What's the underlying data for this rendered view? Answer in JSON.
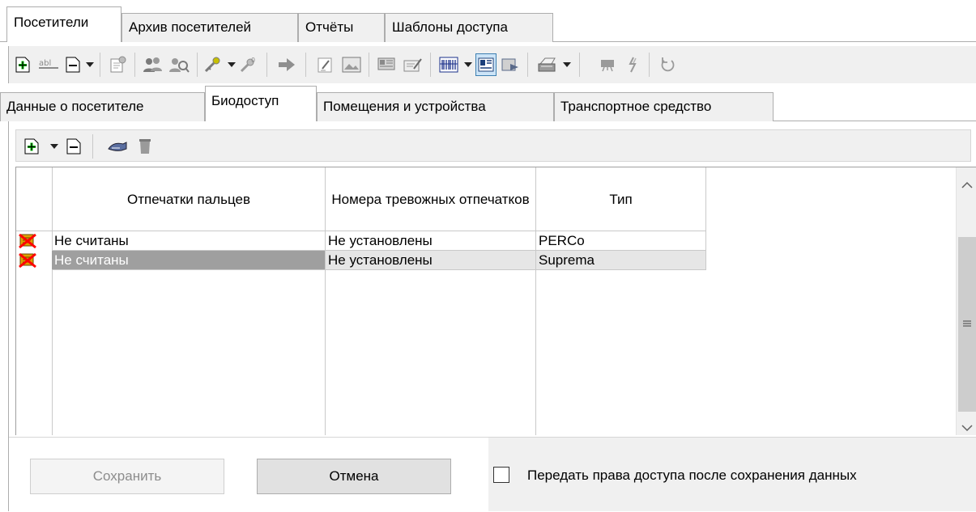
{
  "top_tabs": [
    {
      "label": "Посетители",
      "active": true
    },
    {
      "label": "Архив посетителей",
      "active": false
    },
    {
      "label": "Отчёты",
      "active": false
    },
    {
      "label": "Шаблоны доступа",
      "active": false
    }
  ],
  "inner_tabs": [
    {
      "label": "Данные о посетителе",
      "active": false
    },
    {
      "label": "Биодоступ",
      "active": true
    },
    {
      "label": "Помещения и устройства",
      "active": false
    },
    {
      "label": "Транспортное средство",
      "active": false
    }
  ],
  "toolbar_icons": [
    "add-icon",
    "rename-icon",
    "remove-icon",
    "properties-icon",
    "users-icon",
    "user-search-icon",
    "key-icon",
    "key-reset-icon",
    "arrow-right-icon",
    "edit-doc-icon",
    "image-icon",
    "card-icon",
    "card-edit-icon",
    "barcode-icon",
    "photo-card-icon",
    "photo-card-back-icon",
    "printer-icon",
    "presentation-icon",
    "fingerprint-icon",
    "refresh-icon"
  ],
  "table": {
    "headers": {
      "fingerprints": "Отпечатки пальцев",
      "alarm_numbers": "Номера тревожных отпечатков",
      "type": "Тип"
    },
    "rows": [
      {
        "fingerprints": "Не считаны",
        "alarm_numbers": "Не установлены",
        "type": "PERCo",
        "selected": false
      },
      {
        "fingerprints": "Не считаны",
        "alarm_numbers": "Не установлены",
        "type": "Suprema",
        "selected": true
      }
    ]
  },
  "footer": {
    "save_label": "Сохранить",
    "cancel_label": "Отмена",
    "transfer_checkbox_label": "Передать права доступа после сохранения данных",
    "transfer_checked": false
  },
  "colors": {
    "tab_bg": "#f0f0f0",
    "selected_cell": "#9f9f9f",
    "selected_row": "#e6e6e6",
    "border": "#adadad"
  }
}
